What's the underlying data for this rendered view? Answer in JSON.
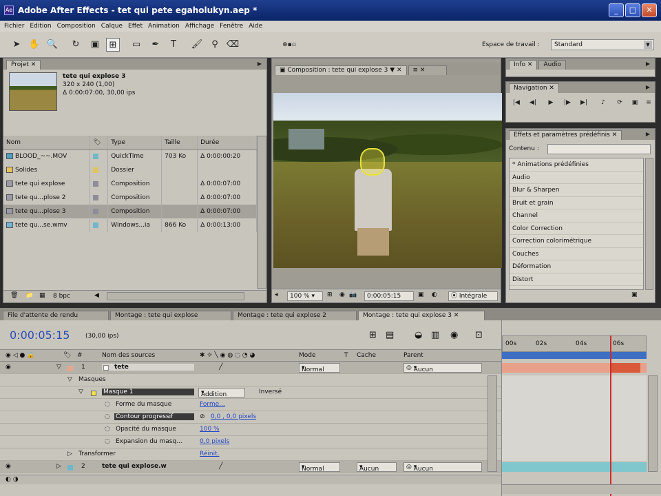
{
  "window": {
    "title": "Adobe After Effects - tet qui pete egaholukyn.aep *"
  },
  "menu": [
    "Fichier",
    "Edition",
    "Composition",
    "Calque",
    "Effet",
    "Animation",
    "Affichage",
    "Fenêtre",
    "Aide"
  ],
  "toolbar": {
    "workspace_label": "Espace de travail :",
    "workspace_value": "Standard"
  },
  "project": {
    "tab": "Projet",
    "selected": {
      "name": "tete qui explose 3",
      "size": "320 x 240 (1,00)",
      "duration": "Δ 0:00:07:00, 30,00 ips"
    },
    "columns": [
      "Nom",
      "Type",
      "Taille",
      "Durée"
    ],
    "rows": [
      {
        "name": "BLOOD_~~.MOV",
        "type": "QuickTime",
        "size": "703 Ko",
        "duration": "Δ 0:00:00:20",
        "icon": "qt"
      },
      {
        "name": "Solides",
        "type": "Dossier",
        "size": "",
        "duration": "",
        "icon": "folder"
      },
      {
        "name": "tete qui explose",
        "type": "Composition",
        "size": "",
        "duration": "Δ 0:00:07:00",
        "icon": "comp"
      },
      {
        "name": "tete qu...plose 2",
        "type": "Composition",
        "size": "",
        "duration": "Δ 0:00:07:00",
        "icon": "comp"
      },
      {
        "name": "tete qu...plose 3",
        "type": "Composition",
        "size": "",
        "duration": "Δ 0:00:07:00",
        "icon": "comp"
      },
      {
        "name": "tete qu...se.wmv",
        "type": "Windows...ia",
        "size": "866 Ko",
        "duration": "Δ 0:00:13:00",
        "icon": "win"
      }
    ],
    "bpc": "8 bpc"
  },
  "composition": {
    "tab": "Composition : tete qui explose 3",
    "zoom": "100 %",
    "timecode": "0:00:05:15",
    "mode": "Intégrale"
  },
  "info": {
    "tabs": [
      "Info",
      "Audio"
    ]
  },
  "navigation": {
    "tab": "Navigation"
  },
  "effects": {
    "tab": "Effets et paramètres prédéfinis",
    "search_label": "Contenu :",
    "items": [
      "* Animations prédéfinies",
      "Audio",
      "Blur & Sharpen",
      "Bruit et grain",
      "Channel",
      "Color Correction",
      "Correction colorimétrique",
      "Couches",
      "Déformation",
      "Distort"
    ]
  },
  "timeline": {
    "tabs": [
      "File d'attente de rendu",
      "Montage : tete qui explose",
      "Montage : tete qui explose 2",
      "Montage : tete qui explose 3"
    ],
    "timecode": "0:00:05:15",
    "fps": "(30,00 ips)",
    "columns": {
      "source": "Nom des sources",
      "mode": "Mode",
      "t": "T",
      "cache": "Cache",
      "parent": "Parent"
    },
    "ruler": [
      "00s",
      "02s",
      "04s",
      "06s"
    ],
    "layer1": {
      "num": "1",
      "name": "tete",
      "mode": "Normal",
      "parent": "Aucun"
    },
    "masks": "Masques",
    "mask1": {
      "name": "Masque 1",
      "mode": "Addition",
      "inverted": "Inversé"
    },
    "props": [
      {
        "name": "Forme du masque",
        "value": "Forme..."
      },
      {
        "name": "Contour progressif",
        "value": "0,0 , 0,0 pixels"
      },
      {
        "name": "Opacité du masque",
        "value": "100 %"
      },
      {
        "name": "Expansion du masq...",
        "value": "0,0 pixels"
      }
    ],
    "transform": {
      "name": "Transformer",
      "value": "Réinit."
    },
    "layer2": {
      "num": "2",
      "name": "tete qui explose.w",
      "mode": "Normal",
      "cache": "Aucun",
      "parent": "Aucun"
    }
  }
}
